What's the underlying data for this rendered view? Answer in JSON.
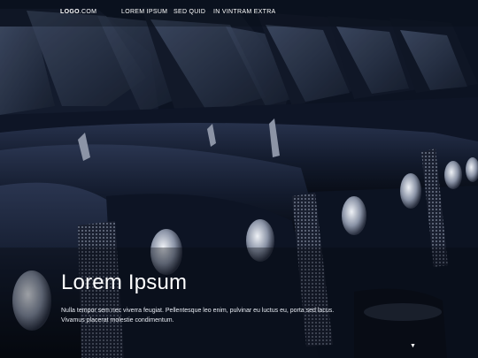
{
  "nav": {
    "logo_bold": "LOGO",
    "logo_rest": ".COM",
    "links": [
      "LOREM IPSUM",
      "SED QUID",
      "IN VINTRAM EXTRA"
    ]
  },
  "hero": {
    "title": "Lorem Ipsum",
    "description": "Nulla tempor sem nec viverra feugiat. Pellentesque leo enim, pulvinar eu luctus eu, porta sed lacus. Vivamus placerat molestie condimentum.",
    "background": "Rows of black taxis",
    "scroll_icon": "caret-down-icon"
  },
  "colors": {
    "accent": "#ffffff",
    "overlay": "#0a0e18"
  }
}
